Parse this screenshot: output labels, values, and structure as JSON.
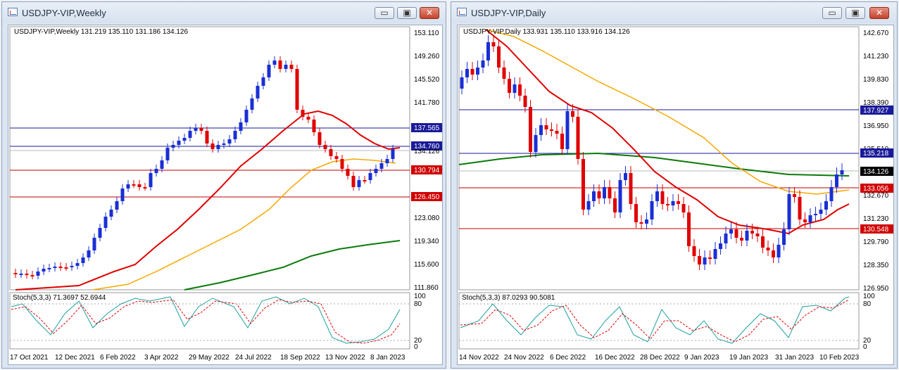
{
  "left_window": {
    "title": "USDJPY-VIP,Weekly",
    "buttons": {
      "minimize": "▭",
      "restore": "▣",
      "close": "✕"
    },
    "info": "USDJPY-VIP,Weekly  131.219 135.110 131.186 134.126",
    "stoch_label": "Stoch(5,3,3) 71.3697 52.6944",
    "price_labels": [
      "153.110",
      "149.260",
      "145.520",
      "141.780",
      "137.565",
      "134.760",
      "134.126",
      "130.794",
      "126.450",
      "123.080",
      "119.340",
      "115.600",
      "111.860"
    ],
    "stoch_levels": [
      "100",
      "80",
      "20",
      "0"
    ],
    "x_labels": [
      "17 Oct 2021",
      "12 Dec 2021",
      "6 Feb 2022",
      "3 Apr 2022",
      "29 May 2022",
      "24 Jul 2022",
      "18 Sep 2022",
      "13 Nov 2022",
      "8 Jan 2023"
    ]
  },
  "right_window": {
    "title": "USDJPY-VIP,Daily",
    "buttons": {
      "minimize": "▭",
      "restore": "▣",
      "close": "✕"
    },
    "info": "USDJPY-VIP,Daily  133.931 135.110 133.916 134.126",
    "stoch_label": "Stoch(5,3,3) 87.0293 90.5081",
    "price_labels": [
      "142.670",
      "141.230",
      "139.830",
      "138.390",
      "137.927",
      "136.950",
      "135.510",
      "135.218",
      "134.126",
      "133.056",
      "132.670",
      "131.230",
      "130.548",
      "129.790",
      "128.350",
      "126.950"
    ],
    "stoch_levels": [
      "100",
      "80",
      "20",
      "0"
    ],
    "x_labels": [
      "14 Nov 2022",
      "24 Nov 2022",
      "6 Dec 2022",
      "16 Dec 2022",
      "28 Dec 2022",
      "9 Jan 2023",
      "19 Jan 2023",
      "31 Jan 2023",
      "10 Feb 2023"
    ]
  },
  "colors": {
    "bull": "#1a2fd4",
    "bear": "#e00000",
    "ma_fast": "#e00000",
    "ma_mid": "#f5a800",
    "ma_slow": "#0b7a0b",
    "stoch_main": "#20a0a0",
    "stoch_signal": "#e00000"
  }
}
